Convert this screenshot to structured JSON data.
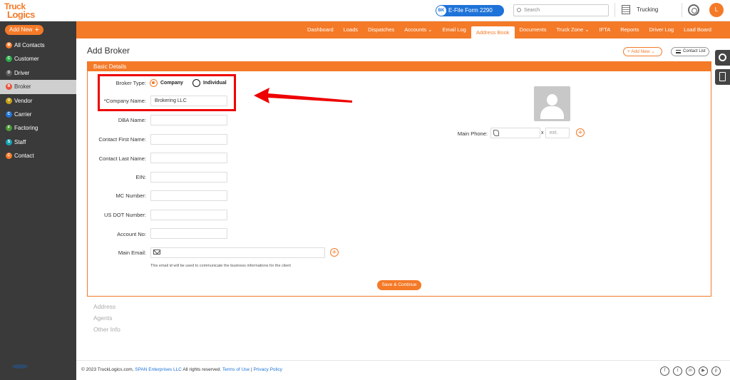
{
  "brand": {
    "logo_line1": "Truck",
    "logo_line2": "Logics"
  },
  "header": {
    "efile_badge": "BK",
    "efile_label": "E-File Form 2290 Now",
    "search_placeholder": "Search",
    "company_name": "Trucking Company",
    "avatar_initial": "L"
  },
  "add_new": {
    "label": "Add New",
    "plus": "+"
  },
  "nav": [
    "Dashboard",
    "Loads",
    "Dispatches",
    "Accounts ⌄",
    "Email Log",
    "Address Book",
    "Documents",
    "Truck Zone ⌄",
    "IFTA",
    "Reports",
    "Driver Log",
    "Load Board"
  ],
  "nav_active": "Address Book",
  "sidebar": [
    {
      "label": "All Contacts",
      "letter": "⊞",
      "color": "#f47a28"
    },
    {
      "label": "Customer",
      "letter": "C",
      "color": "#2eae4a"
    },
    {
      "label": "Driver",
      "letter": "D",
      "color": "#5a5a5a"
    },
    {
      "label": "Broker",
      "letter": "B",
      "color": "#e8523a"
    },
    {
      "label": "Vendor",
      "letter": "V",
      "color": "#c9a21a"
    },
    {
      "label": "Carrier",
      "letter": "C",
      "color": "#1e73d8"
    },
    {
      "label": "Factoring",
      "letter": "F",
      "color": "#4a9a3a"
    },
    {
      "label": "Staff",
      "letter": "S",
      "color": "#16a3b5"
    },
    {
      "label": "Contact",
      "letter": "C",
      "color": "#f47a28"
    }
  ],
  "sidebar_active": "Broker",
  "page": {
    "title": "Add Broker",
    "add_new_label": "+ Add New ⌄",
    "contact_list_label": "Contact List",
    "section_title": "Basic Details"
  },
  "form": {
    "broker_type_label": "Broker Type:",
    "option_company": "Company",
    "option_individual": "Individual",
    "company_name_label": "*Company Name:",
    "company_name_value": "Brokering LLC",
    "dba_label": "DBA Name:",
    "first_name_label": "Contact First Name:",
    "last_name_label": "Contact Last Name:",
    "ein_label": "EIN:",
    "mc_label": "MC Number:",
    "dot_label": "US DOT Number:",
    "account_label": "Account No:",
    "email_label": "Main Email:",
    "email_hint": "This email id will be used to communicate the business informations for the client",
    "phone_label": "Main Phone:",
    "ext_x": "x",
    "ext_placeholder": "ext.",
    "save_label": "Save & Continue"
  },
  "sections": [
    "Address",
    "Agents",
    "Other Info"
  ],
  "footer": {
    "copy_prefix": "© 2023 TruckLogics.com, ",
    "copy_link": "SPAN Enterprises LLC",
    "copy_mid": " All rights reserved. ",
    "terms": "Terms of Use",
    "sep": " | ",
    "privacy": "Privacy Policy",
    "social": [
      "f",
      "t",
      "in",
      "▶",
      "p"
    ]
  },
  "colors": {
    "accent": "#f47a28",
    "sidebar": "#3a3a3a",
    "highlight": "#ee0000",
    "efile": "#1e73d8"
  }
}
